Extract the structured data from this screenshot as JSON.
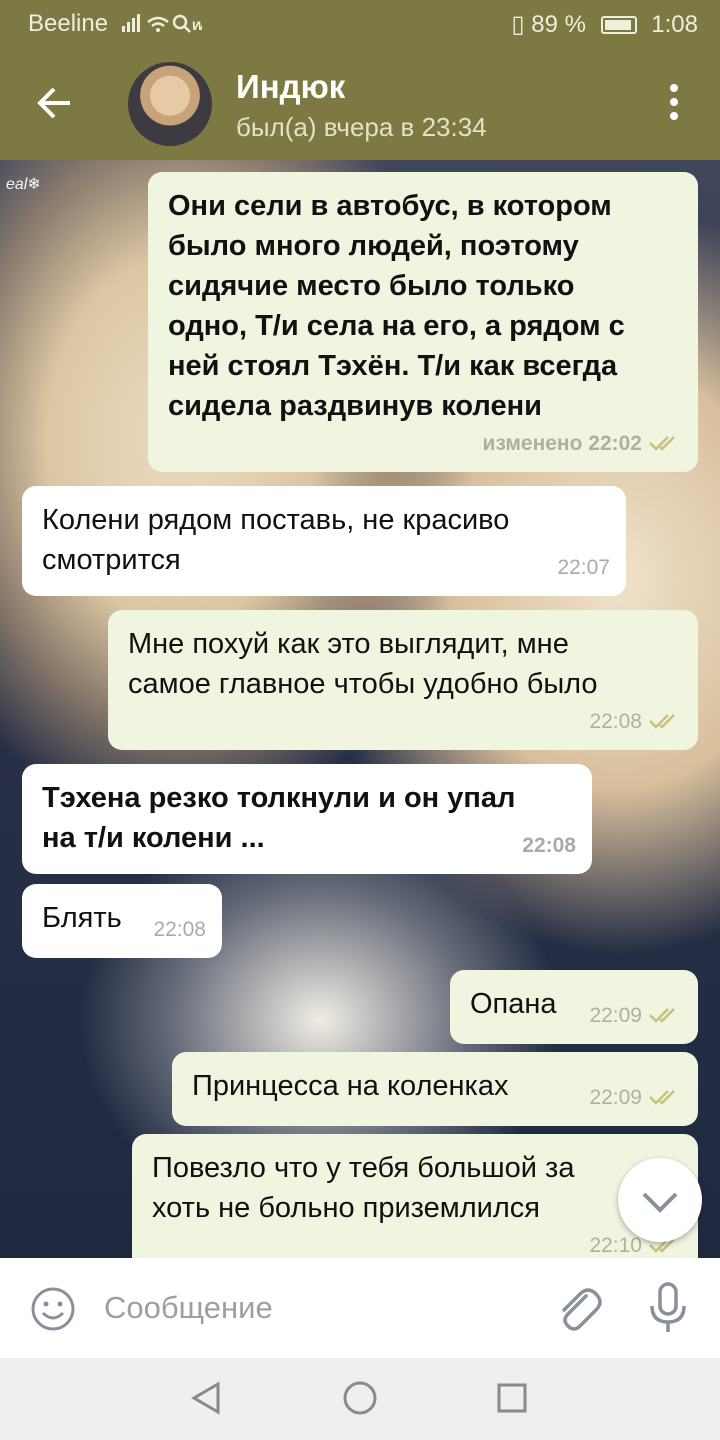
{
  "status_bar": {
    "carrier": "Beeline",
    "battery": "89 %",
    "time": "1:08"
  },
  "header": {
    "title": "Индюк",
    "subtitle": "был(а) вчера в 23:34"
  },
  "background": {
    "decoration": "eal❄"
  },
  "messages": [
    {
      "dir": "out",
      "bold": true,
      "lines": [
        "Они сели в автобус, в котором",
        "было много людей, поэтому",
        "сидячие место было только",
        "одно, Т/и села на его, а рядом с",
        "ней стоял Тэхён. Т/и как всегда",
        "сидела раздвинув колени"
      ],
      "meta": "изменено 22:02"
    },
    {
      "dir": "in",
      "bold": false,
      "lines": [
        "Колени рядом поставь, не красиво",
        "смотрится"
      ],
      "meta": "22:07"
    },
    {
      "dir": "out",
      "bold": false,
      "lines": [
        "Мне похуй как это выглядит, мне",
        "самое главное чтобы удобно было"
      ],
      "meta": "22:08"
    },
    {
      "dir": "in",
      "bold": true,
      "lines": [
        "Тэхена резко толкнули и он упал",
        "на т/и колени ..."
      ],
      "meta": "22:08"
    },
    {
      "dir": "in",
      "bold": false,
      "lines": [
        "Блять"
      ],
      "meta": "22:08"
    },
    {
      "dir": "out",
      "bold": false,
      "lines": [
        "Опана"
      ],
      "meta": "22:09"
    },
    {
      "dir": "out",
      "bold": false,
      "lines": [
        "Принцесса на коленках"
      ],
      "meta": "22:09"
    },
    {
      "dir": "out",
      "bold": false,
      "lines": [
        "Повезло что у тебя большой за",
        "хоть не больно приземлился"
      ],
      "meta": "22:10"
    }
  ],
  "input": {
    "placeholder": "Сообщение"
  },
  "colors": {
    "header": "#7c7a42",
    "bubble_out": "#eff5df",
    "bubble_in": "#ffffff",
    "checks": "#c9c27a"
  },
  "icons": [
    "back-arrow-icon",
    "more-vert-icon",
    "emoji-icon",
    "attach-icon",
    "mic-icon",
    "chevron-down-icon",
    "nav-back-icon",
    "nav-home-icon",
    "nav-recent-icon"
  ]
}
